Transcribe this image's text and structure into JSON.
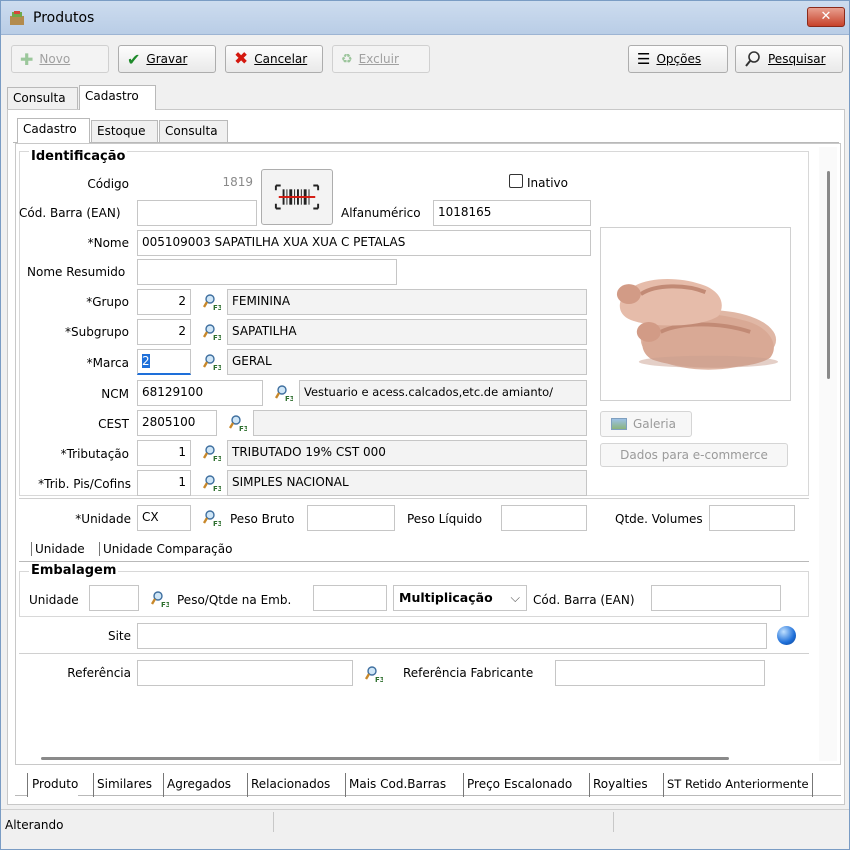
{
  "window": {
    "title": "Produtos"
  },
  "toolbar": {
    "novo": "Novo",
    "gravar": "Gravar",
    "cancelar": "Cancelar",
    "excluir": "Excluir",
    "opcoes": "Opções",
    "pesquisar": "Pesquisar"
  },
  "tabs_main": [
    "Consulta",
    "Cadastro"
  ],
  "tabs_sub": [
    "Cadastro",
    "Estoque",
    "Consulta"
  ],
  "section": {
    "identificacao": "Identificação",
    "embalagem": "Embalagem"
  },
  "fields": {
    "codigo": {
      "label": "Código",
      "value": "1819"
    },
    "inativo": {
      "label": "Inativo"
    },
    "cod_barra": {
      "label": "Cód. Barra (EAN)",
      "value": ""
    },
    "alfanumerico": {
      "label": "Alfanumérico",
      "value": "1018165"
    },
    "nome": {
      "label": "*Nome",
      "value": "005109003 SAPATILHA XUA XUA C PETALAS"
    },
    "nome_resumido": {
      "label": "Nome Resumido",
      "value": ""
    },
    "grupo": {
      "label": "*Grupo",
      "code": "2",
      "desc": "FEMININA"
    },
    "subgrupo": {
      "label": "*Subgrupo",
      "code": "2",
      "desc": "SAPATILHA"
    },
    "marca": {
      "label": "*Marca",
      "code": "2",
      "desc": "GERAL"
    },
    "ncm": {
      "label": "NCM",
      "code": "68129100",
      "desc": "Vestuario e acess.calcados,etc.de amianto/"
    },
    "cest": {
      "label": "CEST",
      "code": "2805100",
      "desc": ""
    },
    "tributacao": {
      "label": "*Tributação",
      "code": "1",
      "desc": "TRIBUTADO 19% CST 000"
    },
    "trib_pis": {
      "label": "*Trib. Pis/Cofins",
      "code": "1",
      "desc": "SIMPLES NACIONAL"
    },
    "unidade": {
      "label": "*Unidade",
      "value": "CX"
    },
    "peso_bruto": {
      "label": "Peso Bruto",
      "value": ""
    },
    "peso_liquido": {
      "label": "Peso Líquido",
      "value": ""
    },
    "qtde_volumes": {
      "label": "Qtde. Volumes",
      "value": ""
    },
    "emb_unidade": {
      "label": "Unidade",
      "value": ""
    },
    "peso_qtde": {
      "label": "Peso/Qtde na Emb.",
      "value": ""
    },
    "operacao": {
      "value": "Multiplicação"
    },
    "emb_cod_barra": {
      "label": "Cód. Barra (EAN)",
      "value": ""
    },
    "site": {
      "label": "Site",
      "value": ""
    },
    "referencia": {
      "label": "Referência",
      "value": ""
    },
    "referencia_fab": {
      "label": "Referência Fabricante",
      "value": ""
    }
  },
  "image_panel": {
    "galeria": "Galeria",
    "ecommerce": "Dados para e-commerce"
  },
  "unit_tabs": [
    "Unidade",
    "Unidade Comparação"
  ],
  "bottom_tabs": [
    "Produto",
    "Similares",
    "Agregados",
    "Relacionados",
    "Mais Cod.Barras",
    "Preço Escalonado",
    "Royalties",
    "ST Retido Anteriormente"
  ],
  "status": {
    "text": "Alterando"
  },
  "colors": {
    "accent": "#1e6fd9",
    "titlebar": "#cddcef",
    "close": "#c7422a"
  }
}
